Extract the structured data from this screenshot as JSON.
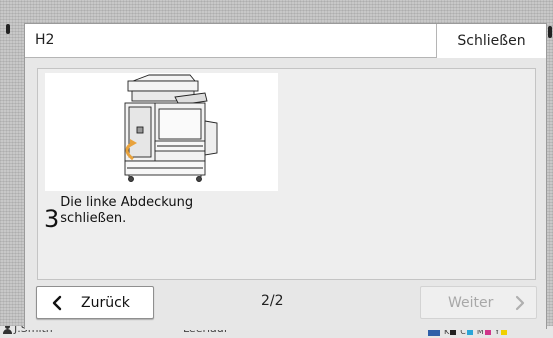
{
  "dialog": {
    "title": "H2",
    "close_label": "Schließen",
    "step_number": "3",
    "step_text": "Die linke Abdeckung\nschließen.",
    "illustration_icon": "printer-left-cover-illustration",
    "footer": {
      "back_label": "Zurück",
      "page_indicator": "2/2",
      "next_label": "Weiter",
      "next_enabled": false
    }
  },
  "background": {
    "user_name": "J.Smith",
    "mode_label": "Leerlauf",
    "ink_labels": [
      "K",
      "C",
      "M",
      "Y"
    ]
  },
  "colors": {
    "accent_orange": "#e8a23c",
    "ink_box": "#2e5fa8"
  }
}
